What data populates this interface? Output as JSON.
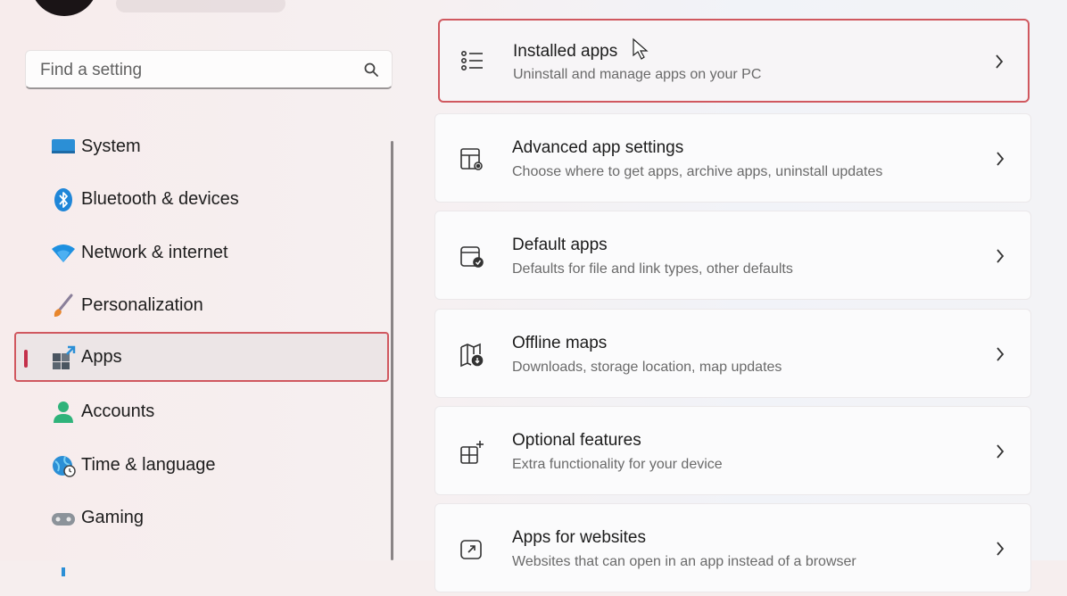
{
  "search": {
    "placeholder": "Find a setting"
  },
  "sidebar": {
    "items": [
      {
        "label": "System",
        "icon": "monitor-icon"
      },
      {
        "label": "Bluetooth & devices",
        "icon": "bluetooth-icon"
      },
      {
        "label": "Network & internet",
        "icon": "wifi-icon"
      },
      {
        "label": "Personalization",
        "icon": "brush-icon"
      },
      {
        "label": "Apps",
        "icon": "apps-icon",
        "selected": true
      },
      {
        "label": "Accounts",
        "icon": "person-icon"
      },
      {
        "label": "Time & language",
        "icon": "globe-clock-icon"
      },
      {
        "label": "Gaming",
        "icon": "gamepad-icon"
      }
    ]
  },
  "main": {
    "cards": [
      {
        "title": "Installed apps",
        "subtitle": "Uninstall and manage apps on your PC",
        "icon": "list-icon",
        "highlighted": true
      },
      {
        "title": "Advanced app settings",
        "subtitle": "Choose where to get apps, archive apps, uninstall updates",
        "icon": "app-settings-icon"
      },
      {
        "title": "Default apps",
        "subtitle": "Defaults for file and link types, other defaults",
        "icon": "default-apps-icon"
      },
      {
        "title": "Offline maps",
        "subtitle": "Downloads, storage location, map updates",
        "icon": "map-icon"
      },
      {
        "title": "Optional features",
        "subtitle": "Extra functionality for your device",
        "icon": "add-grid-icon"
      },
      {
        "title": "Apps for websites",
        "subtitle": "Websites that can open in an app instead of a browser",
        "icon": "open-external-icon"
      }
    ]
  },
  "colors": {
    "accent": "#c4314b",
    "highlight_border": "#d0585f"
  }
}
